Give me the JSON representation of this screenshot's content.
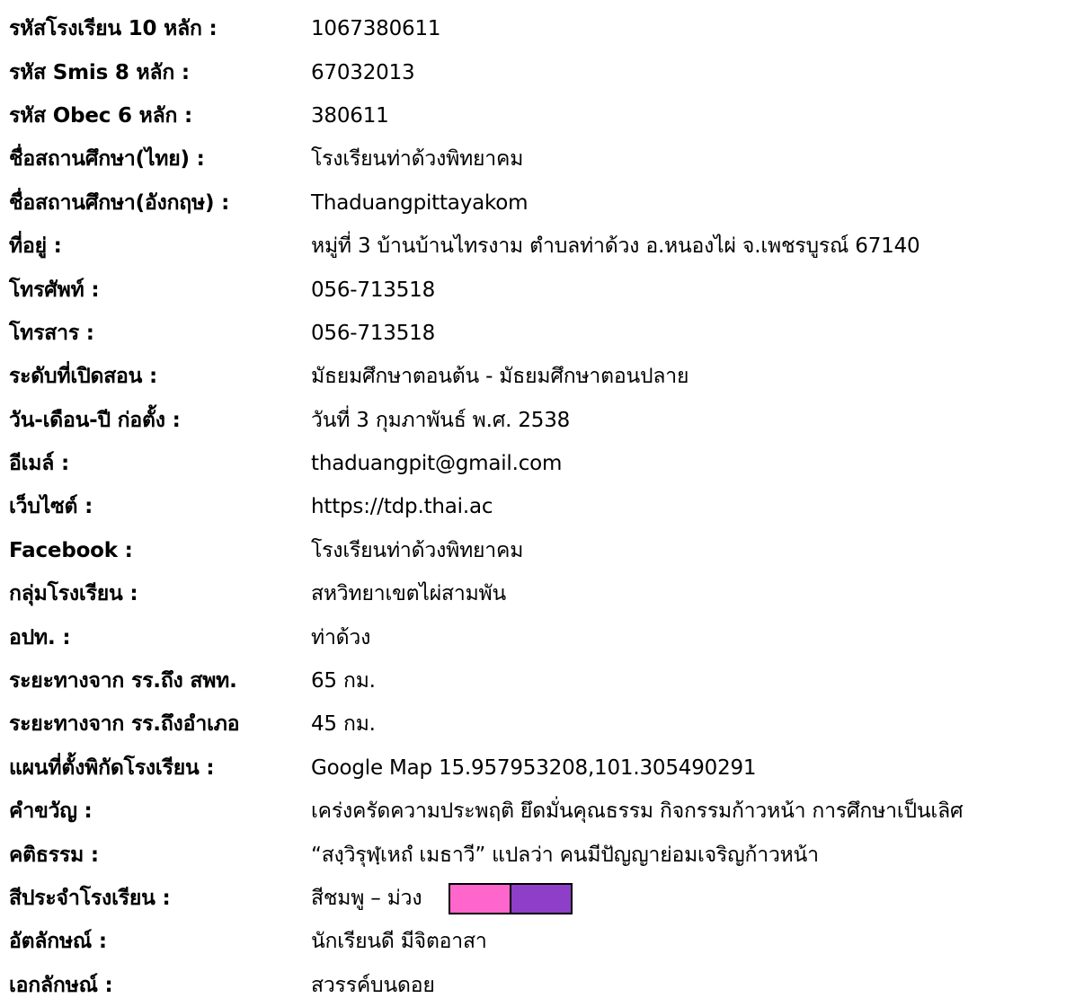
{
  "school_info": [
    {
      "label": "รหัสโรงเรียน 10 หลัก  :",
      "value": "1067380611"
    },
    {
      "label": "รหัส Smis 8 หลัก  :",
      "value": "67032013"
    },
    {
      "label": "รหัส Obec 6 หลัก  :",
      "value": "380611"
    },
    {
      "label": "ชื่อสถานศึกษา(ไทย)  :",
      "value": "โรงเรียนท่าด้วงพิทยาคม"
    },
    {
      "label": "ชื่อสถานศึกษา(อังกฤษ)  :",
      "value": "Thaduangpittayakom"
    },
    {
      "label": "ที่อยู่  :",
      "value": "หมู่ที่ 3 บ้านบ้านไทรงาม ตำบลท่าด้วง อ.หนองไผ่ จ.เพชรบูรณ์ 67140"
    },
    {
      "label": "โทรศัพท์  :",
      "value": "056-713518"
    },
    {
      "label": "โทรสาร  :",
      "value": "056-713518"
    },
    {
      "label": "ระดับที่เปิดสอน  :",
      "value": "มัธยมศึกษาตอนต้น - มัธยมศึกษาตอนปลาย"
    },
    {
      "label": "วัน-เดือน-ปี ก่อตั้ง  :",
      "value": "วันที่ 3 กุมภาพันธ์  พ.ศ. 2538"
    },
    {
      "label": "อีเมล์  :",
      "value": "thaduangpit@gmail.com"
    },
    {
      "label": "เว็บไซต์  :",
      "value": "https://tdp.thai.ac"
    },
    {
      "label": "Facebook  :",
      "value": "โรงเรียนท่าด้วงพิทยาคม"
    },
    {
      "label": "กลุ่มโรงเรียน  :",
      "value": "สหวิทยาเขตไผ่สามพัน"
    },
    {
      "label": "อปท.  :",
      "value": "ท่าด้วง"
    },
    {
      "label": "ระยะทางจาก รร.ถึง สพท.",
      "value": "65 กม."
    },
    {
      "label": "ระยะทางจาก รร.ถึงอำเภอ",
      "value": "45 กม."
    },
    {
      "label": "แผนที่ตั้งพิกัดโรงเรียน   :",
      "value": "Google Map 15.957953208,101.305490291"
    },
    {
      "label": "คำขวัญ   :",
      "value": "เคร่งครัดความประพฤติ ยึดมั่นคุณธรรม กิจกรรมก้าวหน้า การศึกษาเป็นเลิศ"
    },
    {
      "label": "คติธรรม   :",
      "value": "“สงฺวิรุฬฺเหถํ  เมธาวี”  แปลว่า  คนมีปัญญาย่อมเจริญก้าวหน้า"
    },
    {
      "label": "สีประจำโรงเรียน   :",
      "value": "สีชมพู – ม่วง"
    },
    {
      "label": "อัตลักษณ์  :",
      "value": "นักเรียนดี  มีจิตอาสา"
    },
    {
      "label": "เอกลักษณ์  :",
      "value": "สวรรค์บนดอย"
    }
  ],
  "colors": {
    "pink": "#FF66CC",
    "purple": "#8E3FC8"
  },
  "icons": {}
}
